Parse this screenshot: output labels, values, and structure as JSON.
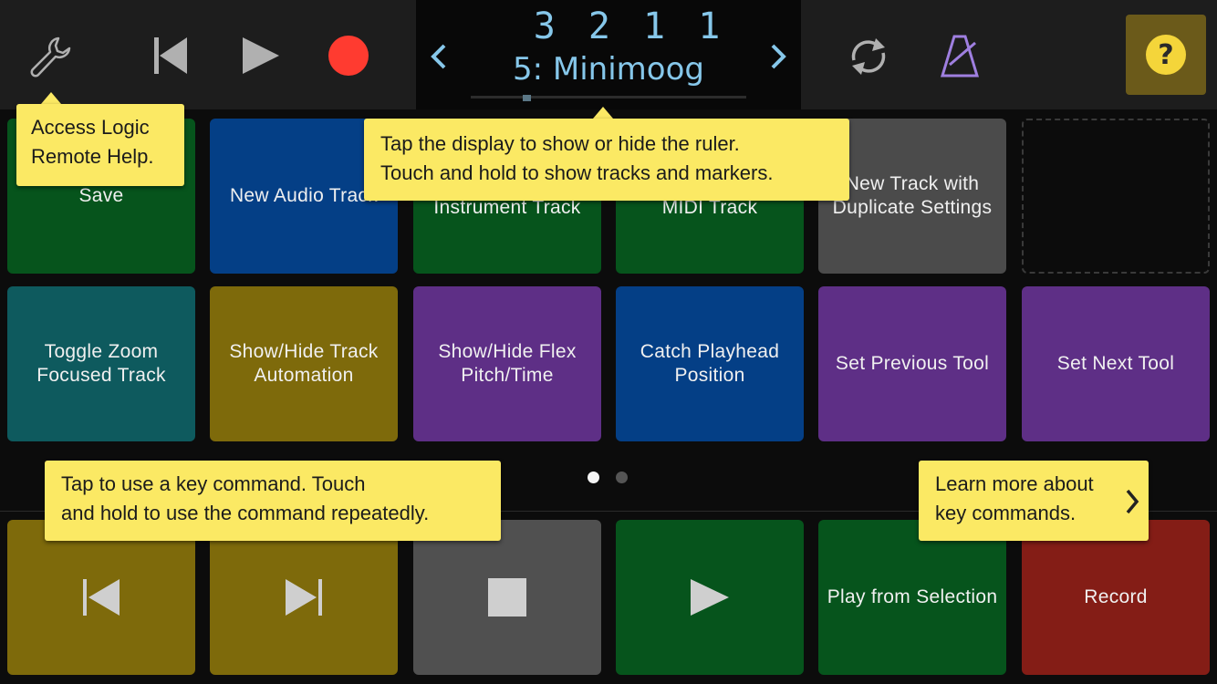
{
  "display": {
    "position": "3 2 1     1",
    "track_name": "5: Minimoog"
  },
  "help": {
    "label": "?"
  },
  "pads_row1": [
    {
      "label": "Save",
      "color": "#06541c"
    },
    {
      "label": "New Audio Track",
      "color": "#043f86"
    },
    {
      "label": "Instrument Track",
      "color": "#06541c"
    },
    {
      "label": "MIDI Track",
      "color": "#06541c"
    },
    {
      "label": "New Track with Duplicate Settings",
      "color": "#4b4b4b"
    },
    {
      "label": "",
      "color": "empty"
    }
  ],
  "pads_row2": [
    {
      "label": "Toggle Zoom Focused Track",
      "color": "#0e5a5e"
    },
    {
      "label": "Show/Hide Track Automation",
      "color": "#7e6a0b"
    },
    {
      "label": "Show/Hide Flex Pitch/Time",
      "color": "#5e2f86"
    },
    {
      "label": "Catch Playhead Position",
      "color": "#043f86"
    },
    {
      "label": "Set Previous Tool",
      "color": "#5e2f86"
    },
    {
      "label": "Set Next Tool",
      "color": "#5e2f86"
    }
  ],
  "pads_row3": [
    {
      "label": "",
      "icon": "skip-back-icon",
      "color": "#7e6a0b"
    },
    {
      "label": "",
      "icon": "skip-forward-icon",
      "color": "#7e6a0b"
    },
    {
      "label": "",
      "icon": "stop-icon",
      "color": "#505050"
    },
    {
      "label": "",
      "icon": "play-icon",
      "color": "#06541c"
    },
    {
      "label": "Play from Selection",
      "color": "#06541c"
    },
    {
      "label": "Record",
      "color": "#841d16"
    }
  ],
  "tooltips": {
    "help": [
      "Access Logic",
      "Remote Help."
    ],
    "display": [
      "Tap the display to show or hide the ruler.",
      "Touch and hold to show tracks and markers."
    ],
    "keycmd": [
      "Tap to use a key command. Touch",
      "and hold to use the command repeatedly."
    ],
    "learn": [
      "Learn more about",
      "key commands."
    ]
  },
  "page_indicator": {
    "pages": 2,
    "current": 1
  },
  "colors": {
    "record": "#ff3b30",
    "metronome": "#9f7fe0",
    "tooltip": "#fbe964"
  }
}
